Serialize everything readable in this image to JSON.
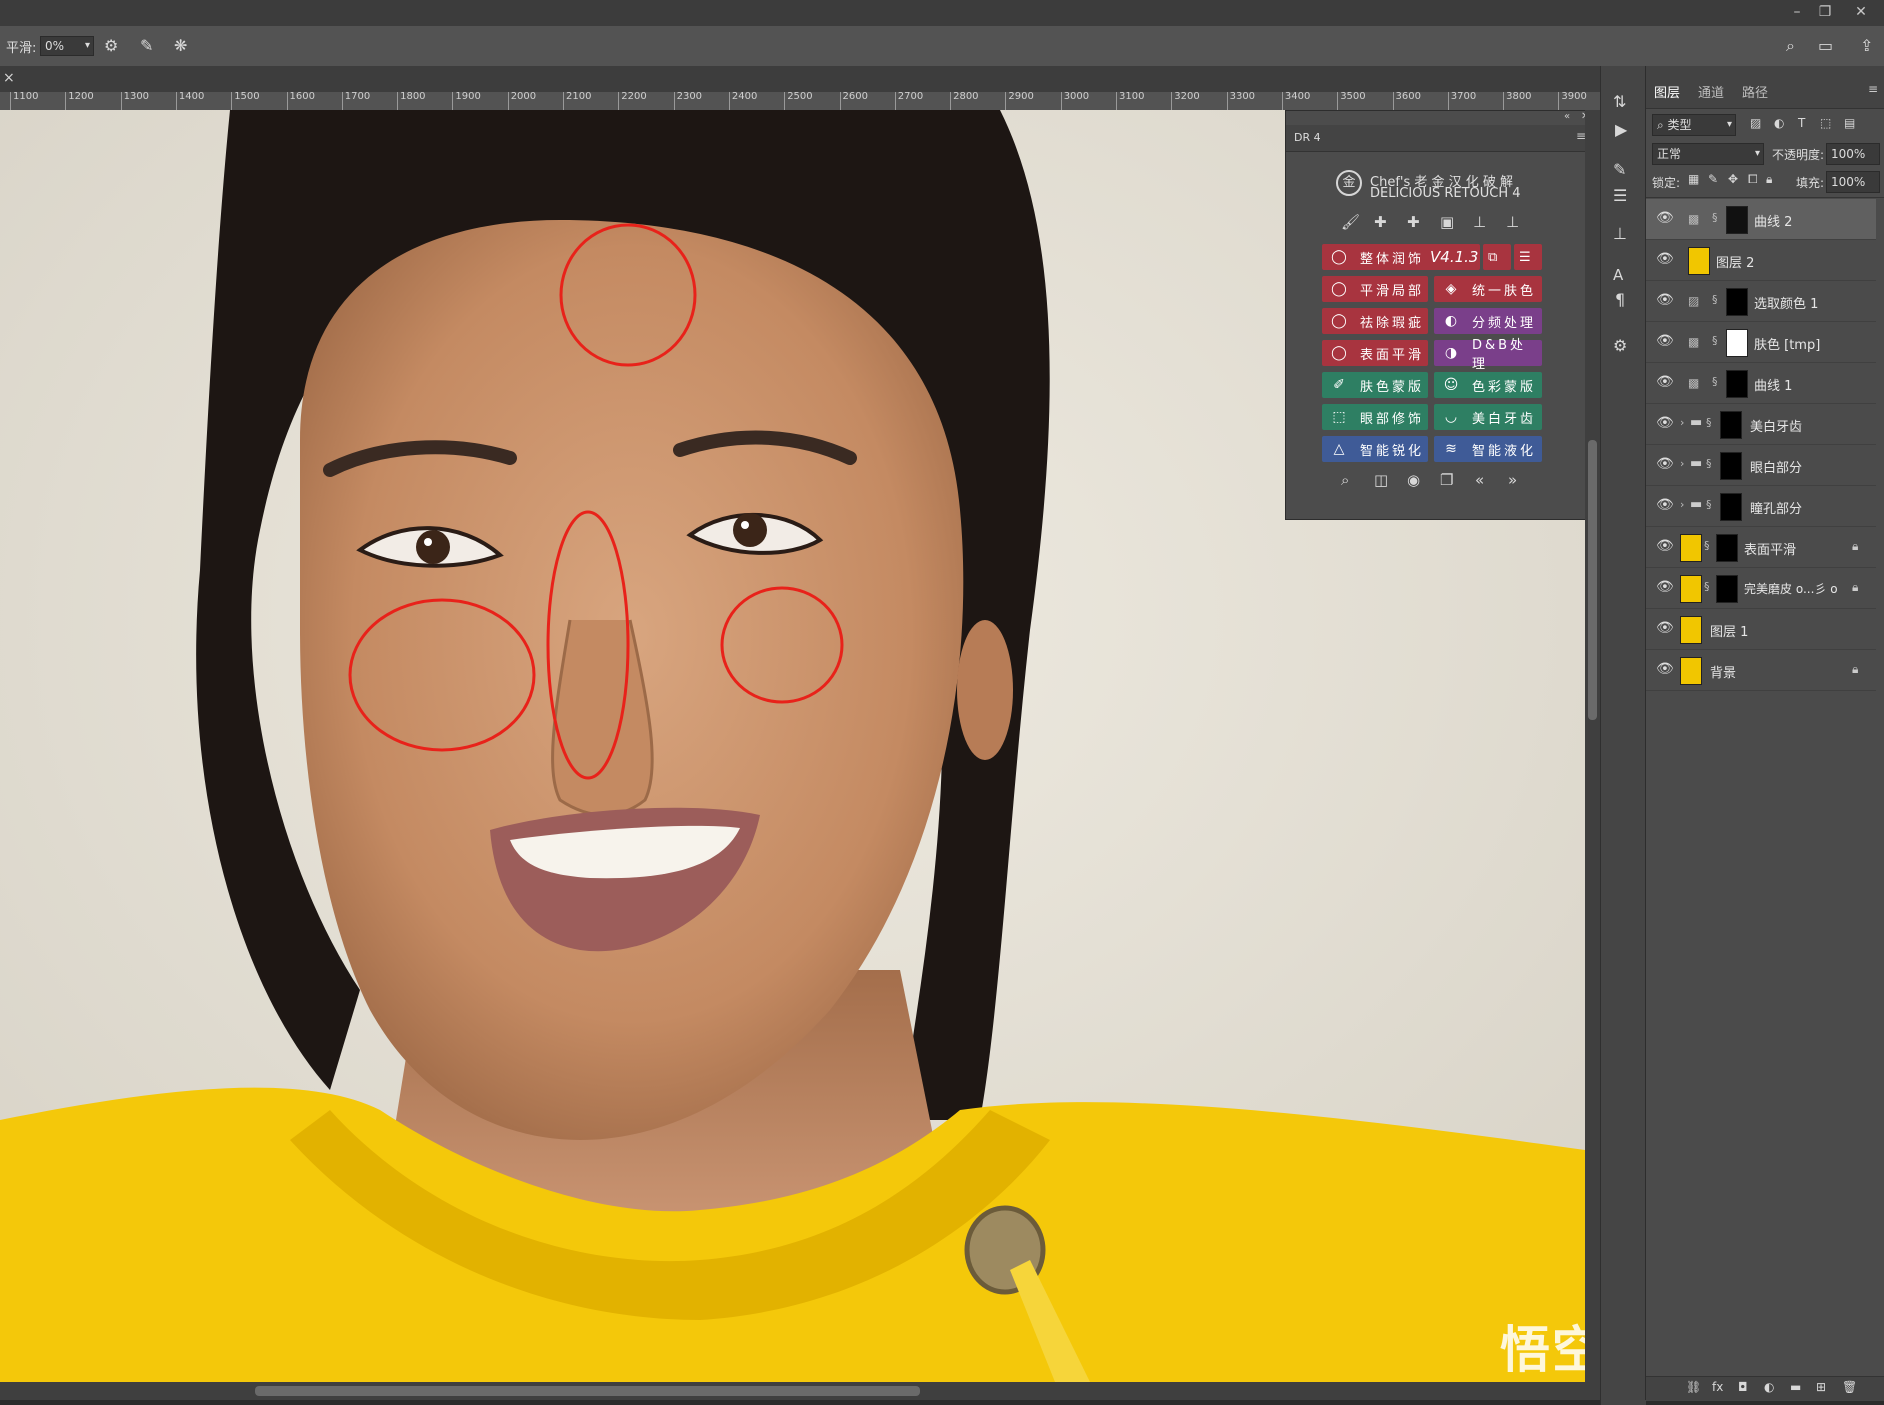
{
  "window": {
    "minimize": "–",
    "restore": "❐",
    "close": "✕"
  },
  "options_bar": {
    "smooth_label": "平滑:",
    "smooth_value": "0%",
    "icons": [
      "gear-icon",
      "brush-settings-icon",
      "butterfly-symmetry-icon"
    ],
    "right_icons": [
      "search-icon",
      "workspace-icon",
      "share-icon"
    ]
  },
  "document_tab": {
    "close": "×"
  },
  "ruler": {
    "ticks": [
      "1100",
      "1200",
      "1300",
      "1400",
      "1500",
      "1600",
      "1700",
      "1800",
      "1900",
      "2000",
      "2100",
      "2200",
      "2300",
      "2400",
      "2500",
      "2600",
      "2700",
      "2800",
      "2900",
      "3000",
      "3100",
      "3200",
      "3300",
      "3400",
      "3500",
      "3600",
      "3700",
      "3800",
      "3900"
    ]
  },
  "dr4_panel": {
    "title": "DR 4",
    "collapse": "«",
    "close": "✕",
    "menu": "≡",
    "brand_line1": "Chef's 老 金 汉 化 破 解",
    "brand_line2": "DELICIOUS RETOUCH 4",
    "top_tools": [
      "brush-icon",
      "bandage-icon",
      "bandage2-icon",
      "chip-icon",
      "stamp-icon",
      "stamp-plus-icon"
    ],
    "version_button": "整体润饰",
    "version": "V4.1.3",
    "buttons_left": [
      "平滑局部",
      "祛除瑕疵",
      "表面平滑",
      "肤色蒙版",
      "眼部修饰",
      "智能锐化"
    ],
    "buttons_right": [
      "统一肤色",
      "分频处理",
      "D&B处理",
      "色彩蒙版",
      "美白牙齿",
      "智能液化"
    ],
    "bottom_tools": [
      "zoom-icon",
      "compare-icon",
      "eye-icon",
      "copy-icon",
      "«",
      "»"
    ]
  },
  "layers_panel": {
    "tabs": [
      "图层",
      "通道",
      "路径"
    ],
    "filter_type": "类型",
    "blend_mode": "正常",
    "opacity_label": "不透明度:",
    "opacity_value": "100%",
    "lock_label": "锁定:",
    "fill_label": "填充:",
    "fill_value": "100%",
    "layers": [
      {
        "name": "曲线 2",
        "selected": true
      },
      {
        "name": "图层 2"
      },
      {
        "name": "选取颜色 1"
      },
      {
        "name": "肤色 [tmp]"
      },
      {
        "name": "曲线 1"
      },
      {
        "name": "美白牙齿"
      },
      {
        "name": "眼白部分"
      },
      {
        "name": "瞳孔部分"
      },
      {
        "name": "表面平滑"
      },
      {
        "name": "完美磨皮 o...彡 o"
      },
      {
        "name": "图层 1"
      },
      {
        "name": "背景"
      }
    ],
    "footer_icons": [
      "link-icon",
      "fx-icon",
      "mask-icon",
      "adjustment-icon",
      "folder-icon",
      "new-layer-icon",
      "trash-icon"
    ]
  },
  "watermark": "悟空问答",
  "colors": {
    "annotation_red": "#e8221a",
    "hoodie_yellow": "#f4c80a",
    "panel_bg": "#535353"
  }
}
